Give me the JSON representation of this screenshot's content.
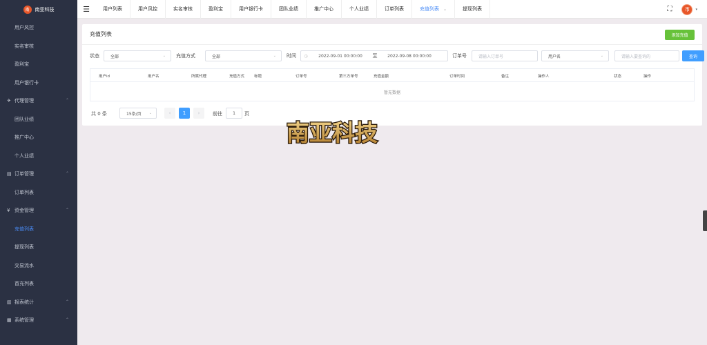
{
  "brand": {
    "name": "南亚科技",
    "logo_char": "南"
  },
  "sidebar": {
    "items": [
      {
        "label": "用户风控",
        "group": false,
        "active": false
      },
      {
        "label": "实名审核",
        "group": false,
        "active": false
      },
      {
        "label": "盈利宝",
        "group": false,
        "active": false
      },
      {
        "label": "用户银行卡",
        "group": false,
        "active": false
      },
      {
        "label": "代理管理",
        "group": true,
        "icon": "send-icon",
        "active": false
      },
      {
        "label": "团队业绩",
        "group": false,
        "active": false
      },
      {
        "label": "推广中心",
        "group": false,
        "active": false
      },
      {
        "label": "个人业绩",
        "group": false,
        "active": false
      },
      {
        "label": "订单管理",
        "group": true,
        "icon": "order-icon",
        "active": false
      },
      {
        "label": "订单列表",
        "group": false,
        "active": false
      },
      {
        "label": "资金管理",
        "group": true,
        "icon": "money-icon",
        "active": false
      },
      {
        "label": "充值列表",
        "group": false,
        "active": true
      },
      {
        "label": "提现列表",
        "group": false,
        "active": false
      },
      {
        "label": "交易流水",
        "group": false,
        "active": false
      },
      {
        "label": "首充列表",
        "group": false,
        "active": false
      },
      {
        "label": "报表统计",
        "group": true,
        "icon": "chart-icon",
        "active": false
      },
      {
        "label": "系统管理",
        "group": true,
        "icon": "system-icon",
        "active": false
      }
    ]
  },
  "tabs": [
    {
      "label": "用户列表",
      "active": false
    },
    {
      "label": "用户风控",
      "active": false
    },
    {
      "label": "实名审核",
      "active": false
    },
    {
      "label": "盈利宝",
      "active": false
    },
    {
      "label": "用户银行卡",
      "active": false
    },
    {
      "label": "团队业绩",
      "active": false
    },
    {
      "label": "推广中心",
      "active": false
    },
    {
      "label": "个人业绩",
      "active": false
    },
    {
      "label": "订单列表",
      "active": false
    },
    {
      "label": "充值列表",
      "active": true
    },
    {
      "label": "提现列表",
      "active": false
    }
  ],
  "user": {
    "avatar_char": "币"
  },
  "card": {
    "title": "充值列表",
    "add_label": "添加充值"
  },
  "filters": {
    "status_label": "状态",
    "status_value": "全部",
    "method_label": "充值方式",
    "method_value": "全部",
    "time_label": "时间",
    "date_start": "2022-09-01 00:00:00",
    "date_sep": "至",
    "date_end": "2022-09-08 00:00:00",
    "order_label": "订单号",
    "order_placeholder": "请输入订单号",
    "user_select": "用户名",
    "user_placeholder": "请输入要查询的",
    "search_label": "查询"
  },
  "table": {
    "columns": [
      "用户id",
      "用户名",
      "所属代理",
      "充值方式",
      "标题",
      "订单号",
      "第三方单号",
      "充值金额",
      "订单时间",
      "备注",
      "操作人",
      "状态",
      "操作"
    ],
    "empty": "暂无数据"
  },
  "pager": {
    "total": "共 0 条",
    "page_size": "15条/页",
    "prev": "‹",
    "page": "1",
    "next": "›",
    "goto_label": "前往",
    "goto_value": "1",
    "page_unit": "页"
  },
  "watermark": {
    "text": "南亚科技"
  },
  "colors": {
    "sidebar": "#2b3143",
    "primary": "#409eff",
    "success": "#67c23a",
    "accent": "#e8572a"
  }
}
